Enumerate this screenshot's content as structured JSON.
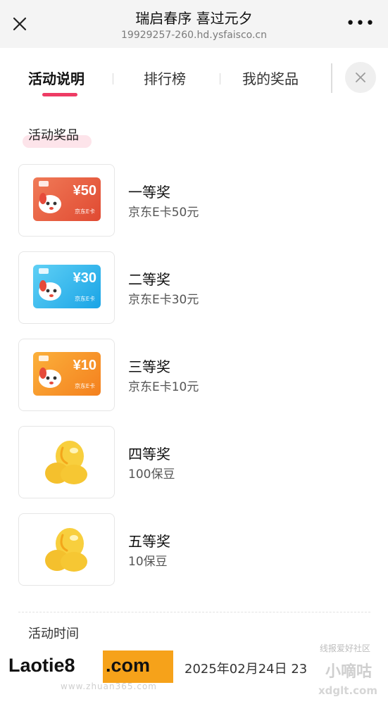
{
  "topbar": {
    "title": "瑞启春序 喜过元夕",
    "url": "19929257-260.hd.ysfaisco.cn",
    "more": "•••"
  },
  "tabs": [
    {
      "label": "活动说明",
      "active": true
    },
    {
      "label": "排行榜",
      "active": false
    },
    {
      "label": "我的奖品",
      "active": false
    }
  ],
  "section_title": "活动奖品",
  "prizes": [
    {
      "name": "一等奖",
      "desc": "京东E卡50元",
      "card_value": "¥50",
      "card_caption": "京东E卡",
      "card_color": "#ea5a3c"
    },
    {
      "name": "二等奖",
      "desc": "京东E卡30元",
      "card_value": "¥30",
      "card_caption": "京东E卡",
      "card_color": "#2fb6ef"
    },
    {
      "name": "三等奖",
      "desc": "京东E卡10元",
      "card_value": "¥10",
      "card_caption": "京东E卡",
      "card_color": "#f7941d"
    },
    {
      "name": "四等奖",
      "desc": "100保豆"
    },
    {
      "name": "五等奖",
      "desc": "10保豆"
    }
  ],
  "time_section": {
    "title": "活动时间",
    "text": "2025年02月24日 23"
  },
  "watermarks": {
    "laotie": "Laotie8",
    "com": ".com",
    "zhuan": "www.zhuan365.com",
    "dig_top": "线报爱好社区",
    "dig": "小嘀咕",
    "dig_url": "xdglt.com"
  },
  "colors": {
    "accent": "#ee3b64",
    "topbar_bg": "#f4f4f4",
    "bean": "#f7c835"
  }
}
